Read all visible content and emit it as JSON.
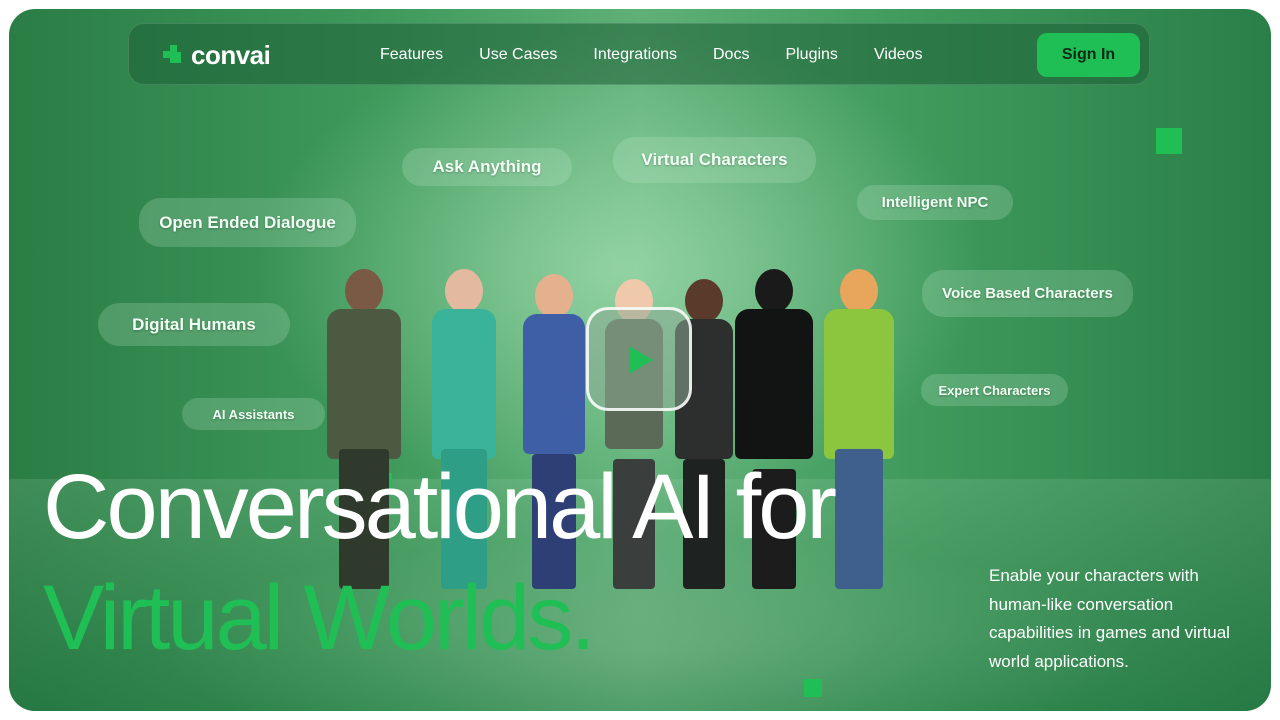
{
  "brand": {
    "name": "convai",
    "accent": "#1fbf55"
  },
  "nav": {
    "links": [
      "Features",
      "Use Cases",
      "Integrations",
      "Docs",
      "Plugins",
      "Videos"
    ],
    "signin": "Sign In"
  },
  "tags": [
    "Ask Anything",
    "Virtual Characters",
    "Intelligent NPC",
    "Open Ended Dialogue",
    "Voice Based Characters",
    "Digital Humans",
    "AI Assistants",
    "Expert Characters"
  ],
  "hero": {
    "line1": "Conversational AI for",
    "line2": "Virtual Worlds.",
    "subtitle": "Enable your characters with human-like conversation capabilities in games and virtual world applications."
  },
  "icons": {
    "play": "play-icon",
    "logo": "convai-logo-icon"
  }
}
